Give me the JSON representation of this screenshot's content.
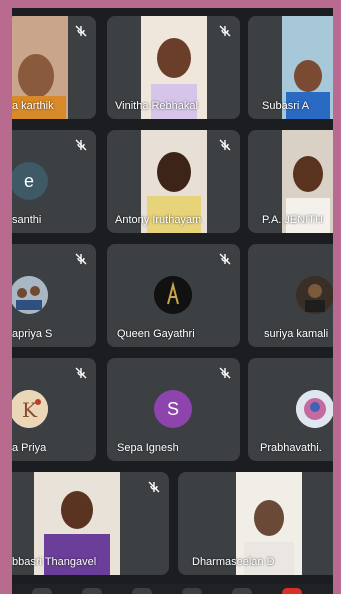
{
  "participants": [
    {
      "name": "a karthik",
      "muted": true
    },
    {
      "name": "Vinitha Rebhakal",
      "muted": true
    },
    {
      "name": "Subasri A",
      "muted": false
    },
    {
      "name": "santhi",
      "muted": true,
      "initial": "e"
    },
    {
      "name": "Antony Iruthayam",
      "muted": true
    },
    {
      "name": "P.A. JENITH",
      "muted": false
    },
    {
      "name": "apriya S",
      "muted": true
    },
    {
      "name": "Queen Gayathri",
      "muted": true
    },
    {
      "name": "suriya kamali",
      "muted": false
    },
    {
      "name": "a Priya",
      "muted": true
    },
    {
      "name": "Sepa Ignesh",
      "muted": true,
      "initial": "S"
    },
    {
      "name": "Prabhavathi.",
      "muted": false
    },
    {
      "name": "bbasri Thangavel",
      "muted": true
    },
    {
      "name": "Dharmaseelan D",
      "muted": false
    }
  ],
  "colors": {
    "background": "#b86a8f",
    "stage": "#1c1d20",
    "tile": "#3c4043",
    "avatar_teal": "#3d5a66",
    "avatar_purple": "#8e44ad"
  },
  "icons": {
    "mute": "mic-off-icon"
  }
}
